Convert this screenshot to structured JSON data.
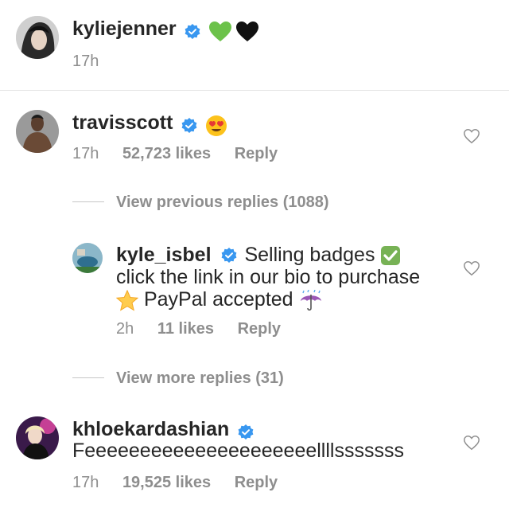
{
  "post": {
    "username": "kyliejenner",
    "emojis": [
      "green-heart",
      "black-heart"
    ],
    "time": "17h"
  },
  "comments": [
    {
      "username": "travisscott",
      "emoji": "heart-eyes",
      "time": "17h",
      "likes": "52,723 likes",
      "reply": "Reply"
    },
    {
      "username": "khloekardashian",
      "text": "Feeeeeeeeeeeeeeeeeeeeellllsssssss",
      "time": "17h",
      "likes": "19,525 likes",
      "reply": "Reply"
    }
  ],
  "thread": {
    "view_previous": "View previous replies (1088)",
    "view_more": "View more replies (31)",
    "reply": {
      "username": "kyle_isbel",
      "line1": "Selling badges",
      "line2": "click the link in our bio to purchase",
      "line3": "PayPal accepted",
      "time": "2h",
      "likes": "11 likes",
      "reply": "Reply"
    }
  },
  "colors": {
    "text": "#262626",
    "secondary": "#8e8e8e",
    "verified": "#3897f0",
    "divider": "#e6e6e6"
  }
}
